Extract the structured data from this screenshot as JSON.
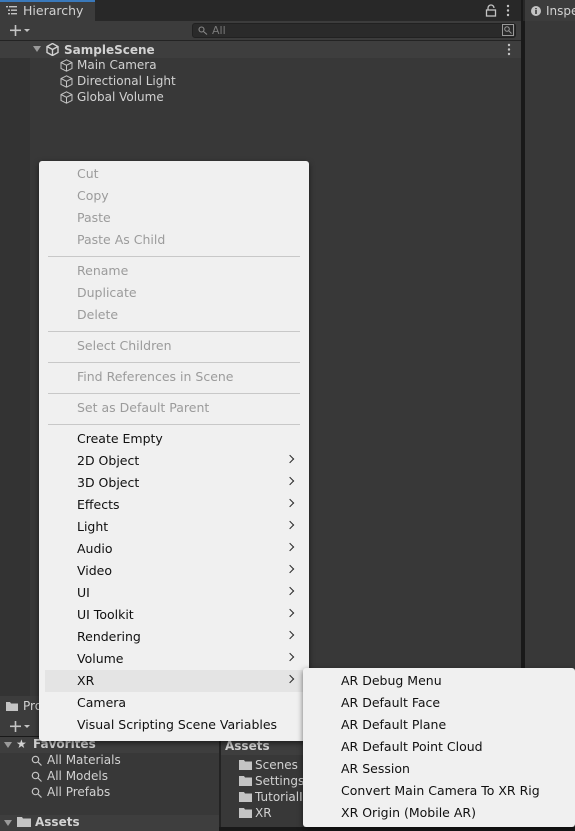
{
  "hierarchy": {
    "tab_label": "Hierarchy",
    "search_placeholder": "All",
    "scene_name": "SampleScene",
    "objects": [
      "Main Camera",
      "Directional Light",
      "Global Volume"
    ]
  },
  "inspector": {
    "tab_label": "Inspe"
  },
  "project": {
    "tab_label": "Pro",
    "favorites_label": "Favorites",
    "favorites": [
      "All Materials",
      "All Models",
      "All Prefabs"
    ],
    "assets_tree_label": "Assets",
    "assets_header": "Assets",
    "folders": [
      "Scenes",
      "Settings",
      "TutorialI",
      "XR"
    ]
  },
  "context_menu": {
    "items": [
      {
        "label": "Cut"
      },
      {
        "label": "Copy"
      },
      {
        "label": "Paste"
      },
      {
        "label": "Paste As Child"
      },
      {
        "label": "Rename"
      },
      {
        "label": "Duplicate"
      },
      {
        "label": "Delete"
      },
      {
        "label": "Select Children"
      },
      {
        "label": "Find References in Scene"
      },
      {
        "label": "Set as Default Parent"
      },
      {
        "label": "Create Empty"
      },
      {
        "label": "2D Object"
      },
      {
        "label": "3D Object"
      },
      {
        "label": "Effects"
      },
      {
        "label": "Light"
      },
      {
        "label": "Audio"
      },
      {
        "label": "Video"
      },
      {
        "label": "UI"
      },
      {
        "label": "UI Toolkit"
      },
      {
        "label": "Rendering"
      },
      {
        "label": "Volume"
      },
      {
        "label": "XR"
      },
      {
        "label": "Camera"
      },
      {
        "label": "Visual Scripting Scene Variables"
      }
    ]
  },
  "xr_submenu": {
    "items": [
      {
        "label": "AR Debug Menu"
      },
      {
        "label": "AR Default Face"
      },
      {
        "label": "AR Default Plane"
      },
      {
        "label": "AR Default Point Cloud"
      },
      {
        "label": "AR Session"
      },
      {
        "label": "Convert Main Camera To XR Rig"
      },
      {
        "label": "XR Origin (Mobile AR)"
      }
    ]
  },
  "colors": {
    "accent": "#3a79bb",
    "menu_bg": "#f0f0f0",
    "panel_bg": "#383838"
  }
}
